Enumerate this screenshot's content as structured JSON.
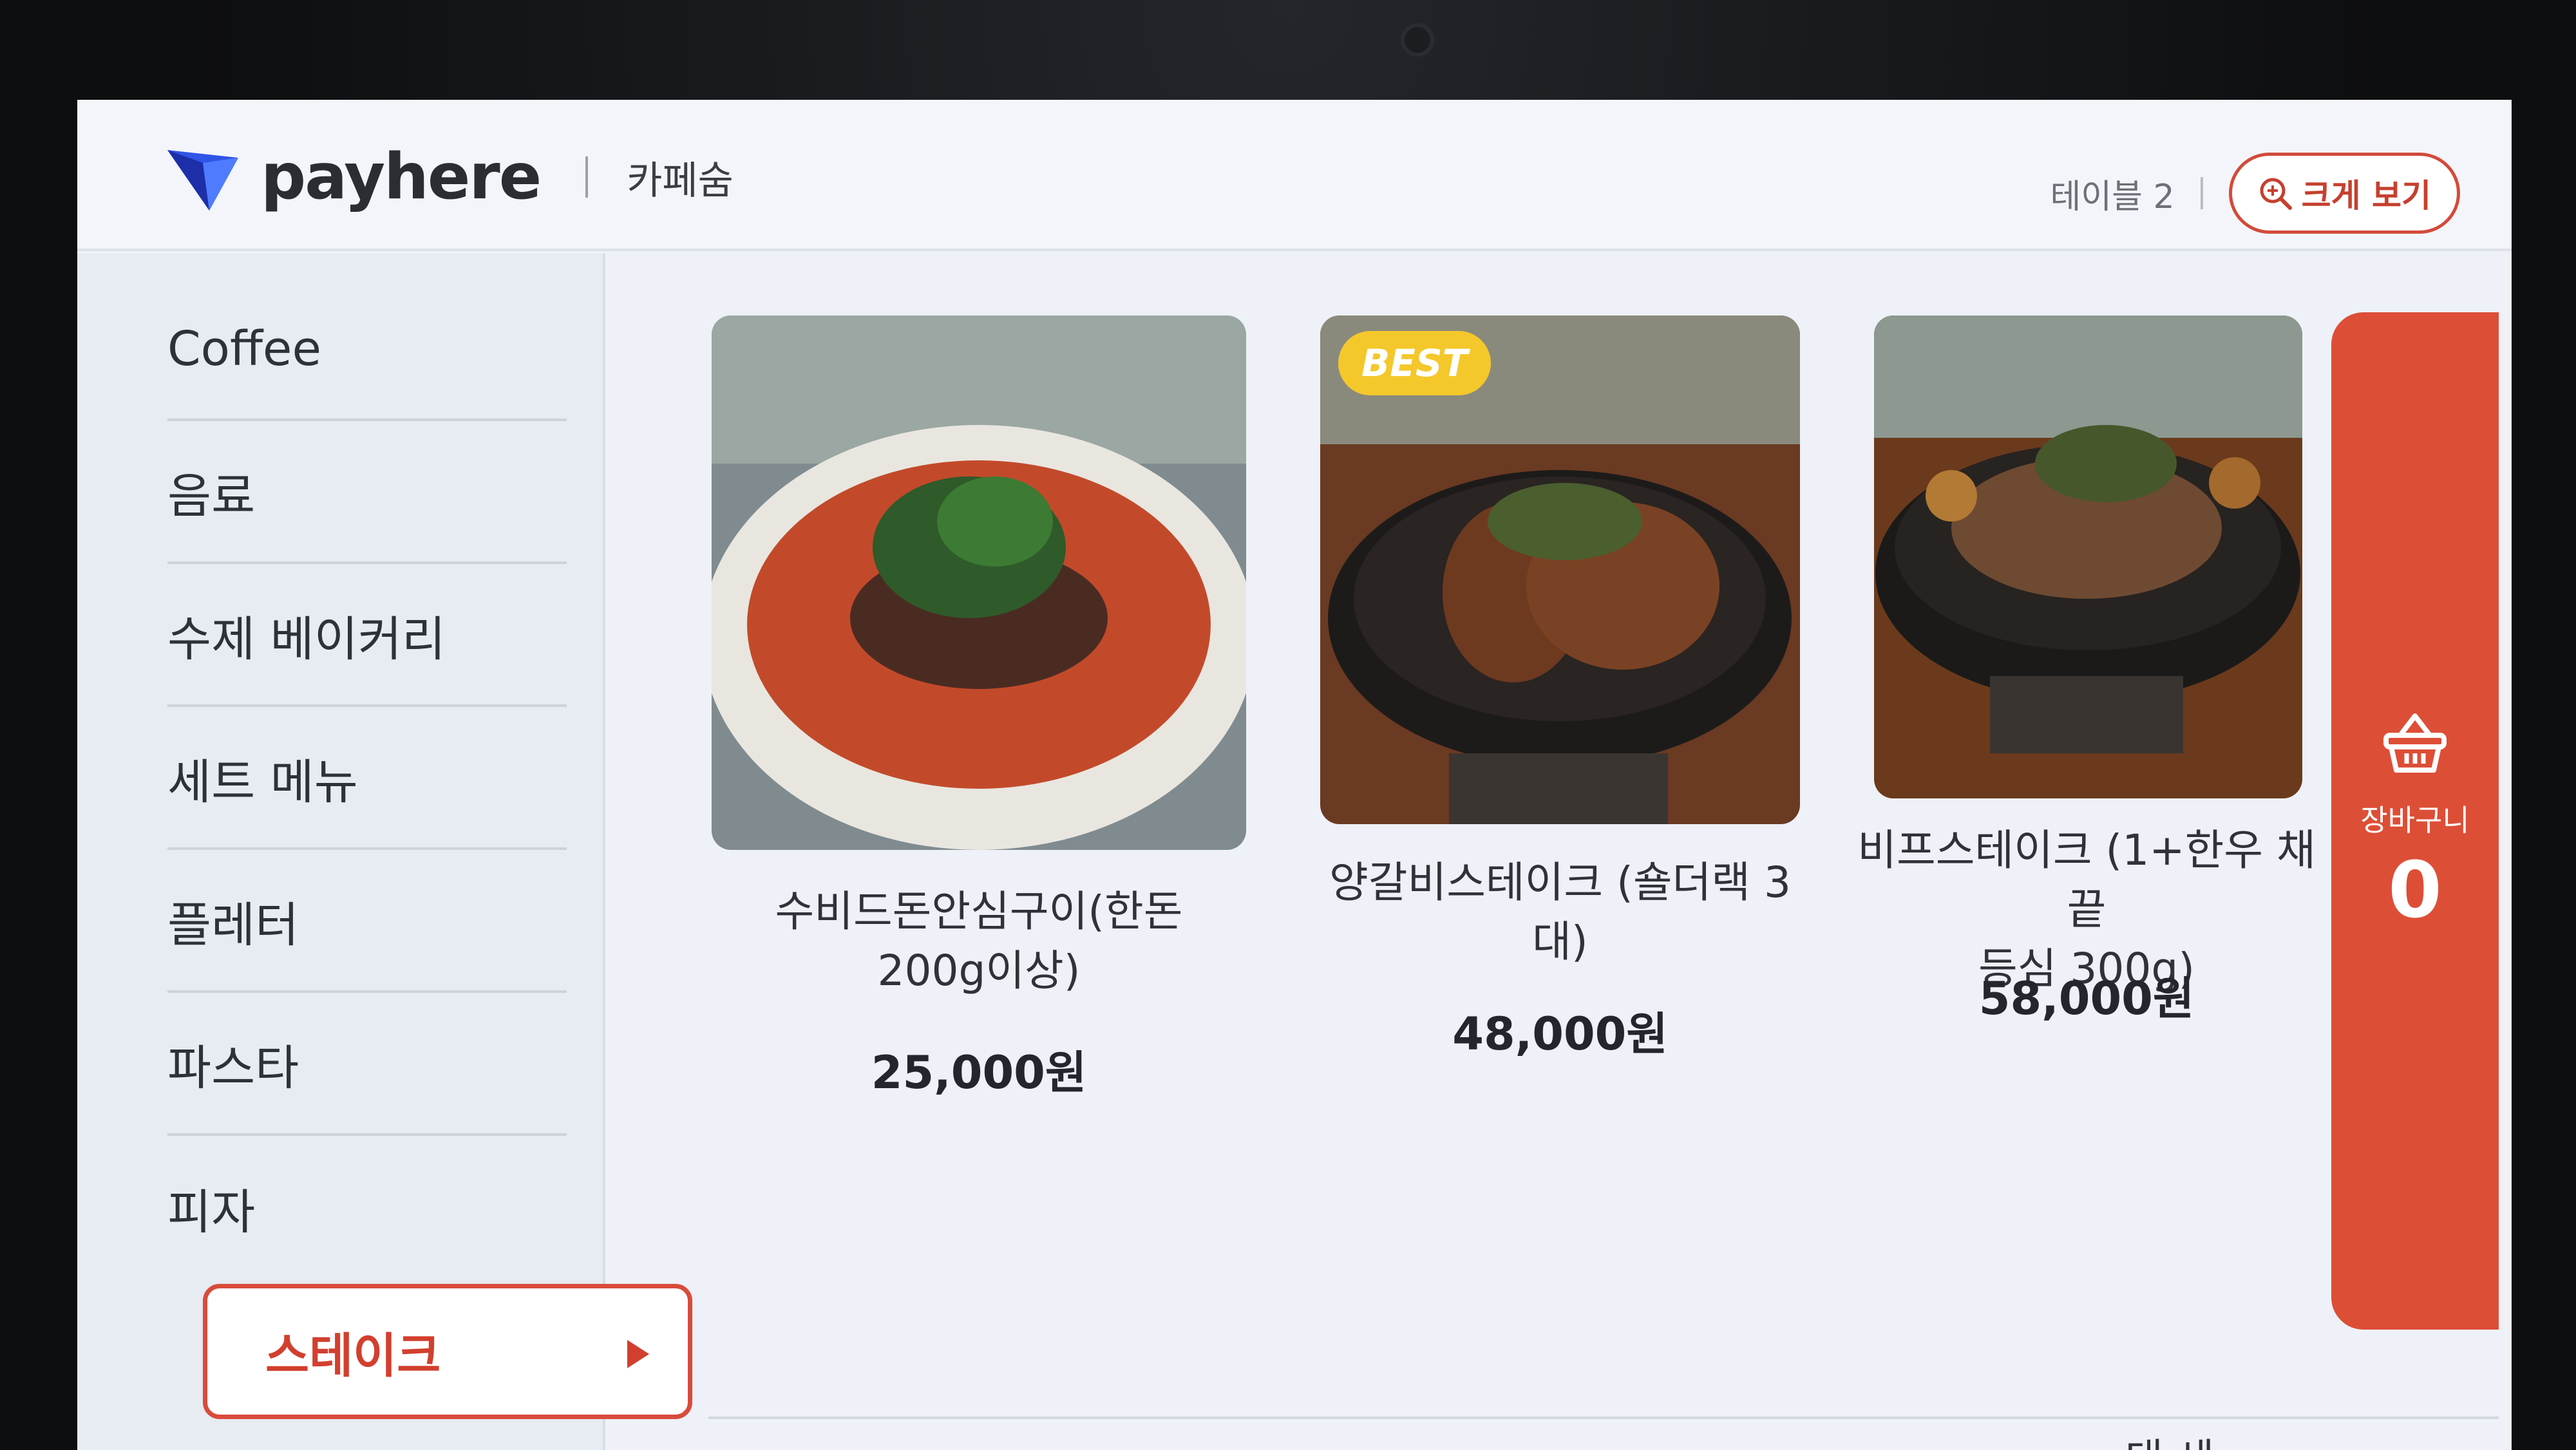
{
  "header": {
    "logo_text": "payhere",
    "store_name": "카페숨",
    "table_label": "테이블 2",
    "zoom_button": "크게 보기",
    "zoom_icon": "zoom-in-icon",
    "accent_color": "#d94b3b"
  },
  "sidebar": {
    "items": [
      {
        "label": "Coffee"
      },
      {
        "label": "음료"
      },
      {
        "label": "수제 베이커리"
      },
      {
        "label": "세트 메뉴"
      },
      {
        "label": "플레터"
      },
      {
        "label": "파스타"
      },
      {
        "label": "피자"
      },
      {
        "label": "스테이크",
        "active": true
      }
    ]
  },
  "products": [
    {
      "name_line1": "수비드돈안심구이(한돈",
      "name_line2": "200g이상)",
      "price": "25,000원"
    },
    {
      "name_line1": "양갈비스테이크 (숄더랙 3",
      "name_line2": "대)",
      "price": "48,000원",
      "badge": "BEST"
    },
    {
      "name_line1": "비프스테이크 (1+한우 채끝",
      "name_line2": "등심 300g)",
      "price": "58,000원"
    }
  ],
  "cart": {
    "label": "장바구니",
    "count": "0",
    "icon": "basket-icon",
    "color": "#dd4e36"
  },
  "bottom_peek": "대 세"
}
